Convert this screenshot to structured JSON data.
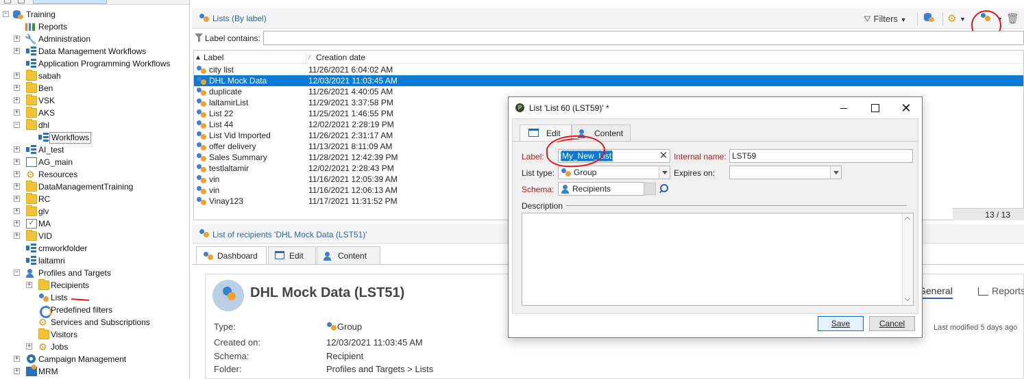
{
  "tree": {
    "items": [
      {
        "label": "Training",
        "icon": "database-icon"
      },
      {
        "label": "Reports",
        "icon": "reports-icon"
      },
      {
        "label": "Administration",
        "icon": "wrench-icon"
      },
      {
        "label": "Data Management Workflows",
        "icon": "workflow-icon"
      },
      {
        "label": "Application Programming Workflows",
        "icon": "workflow-icon"
      },
      {
        "label": "sabah",
        "icon": "folder-icon"
      },
      {
        "label": "Ben",
        "icon": "folder-icon"
      },
      {
        "label": "VSK",
        "icon": "folder-icon"
      },
      {
        "label": "AKS",
        "icon": "folder-icon"
      },
      {
        "label": "dhl",
        "icon": "folder-icon"
      },
      {
        "label": "Workflows",
        "icon": "workflow-icon"
      },
      {
        "label": "AI_test",
        "icon": "workflow-icon"
      },
      {
        "label": "AG_main",
        "icon": "box-icon"
      },
      {
        "label": "Resources",
        "icon": "gear-icon"
      },
      {
        "label": "DataManagementTraining",
        "icon": "folder-icon"
      },
      {
        "label": "RC",
        "icon": "folder-icon"
      },
      {
        "label": "glv",
        "icon": "folder-icon"
      },
      {
        "label": "MA",
        "icon": "checkbox-icon"
      },
      {
        "label": "VID",
        "icon": "folder-icon"
      },
      {
        "label": "cmworkfolder",
        "icon": "workflow-icon"
      },
      {
        "label": "laltamri",
        "icon": "workflow-icon"
      },
      {
        "label": "Profiles and Targets",
        "icon": "person-icon"
      },
      {
        "label": "Recipients",
        "icon": "folder-icon"
      },
      {
        "label": "Lists",
        "icon": "list-icon"
      },
      {
        "label": "Predefined filters",
        "icon": "filter-icon"
      },
      {
        "label": "Services and Subscriptions",
        "icon": "gear-icon"
      },
      {
        "label": "Visitors",
        "icon": "folder-icon"
      },
      {
        "label": "Jobs",
        "icon": "gear-icon"
      },
      {
        "label": "Campaign Management",
        "icon": "campaign-icon"
      },
      {
        "label": "MRM",
        "icon": "mrm-icon"
      }
    ]
  },
  "list_panel": {
    "title": "Lists (By label)",
    "filters_label": "Filters",
    "filter_label": "Label contains:",
    "filter_value": "",
    "columns": [
      "Label",
      "Creation date"
    ],
    "rows": [
      {
        "label": "city list",
        "date": "11/26/2021 6:04:02 AM"
      },
      {
        "label": "DHL Mock Data",
        "date": "12/03/2021 11:03:45 AM"
      },
      {
        "label": "duplicate",
        "date": "11/26/2021 4:40:05 AM"
      },
      {
        "label": "laltamirList",
        "date": "11/29/2021 3:37:58 PM"
      },
      {
        "label": "List 22",
        "date": "11/25/2021 1:46:55 PM"
      },
      {
        "label": "List 44",
        "date": "12/02/2021 2:28:19 PM"
      },
      {
        "label": "List Vid Imported",
        "date": "11/26/2021 2:31:17 AM"
      },
      {
        "label": "offer delivery",
        "date": "11/13/2021 8:11:09 AM"
      },
      {
        "label": "Sales Summary",
        "date": "11/28/2021 12:42:39 PM"
      },
      {
        "label": "testlaltamir",
        "date": "12/02/2021 2:28:43 PM"
      },
      {
        "label": "vin",
        "date": "11/16/2021 12:05:39 AM"
      },
      {
        "label": "vin",
        "date": "11/16/2021 12:06:13 AM"
      },
      {
        "label": "Vinay123",
        "date": "11/17/2021 11:31:52 PM"
      }
    ],
    "counter": "13 / 13"
  },
  "detail": {
    "title": "List of recipients 'DHL Mock Data (LST51)'",
    "tabs": [
      "Dashboard",
      "Edit",
      "Content"
    ],
    "name": "DHL Mock Data (LST51)",
    "props": [
      {
        "label": "Type:",
        "value": "Group"
      },
      {
        "label": "Created on:",
        "value": "12/03/2021 11:03:45 AM"
      },
      {
        "label": "Schema:",
        "value": "Recipient"
      },
      {
        "label": "Folder:",
        "value": "Profiles and Targets > Lists"
      }
    ],
    "right_tabs": [
      "General",
      "Reports"
    ],
    "last_modified": "Last modified 5 days ago"
  },
  "dialog": {
    "title": "List 'List 60 (LST59)' *",
    "tabs": [
      "Edit",
      "Content"
    ],
    "label_label": "Label:",
    "label_value": "My_New_List",
    "internal_label": "Internal name:",
    "internal_value": "LST59",
    "list_type_label": "List type:",
    "list_type_value": "Group",
    "expires_label": "Expires on:",
    "expires_value": "",
    "schema_label": "Schema:",
    "schema_value": "Recipients",
    "description_label": "Description",
    "description_value": "",
    "save_label": "Save",
    "cancel_label": "Cancel"
  },
  "colors": {
    "selection": "#0a7ad4",
    "link_title": "#2a64a8",
    "required_label": "#c01818",
    "annotation": "#e01818"
  }
}
